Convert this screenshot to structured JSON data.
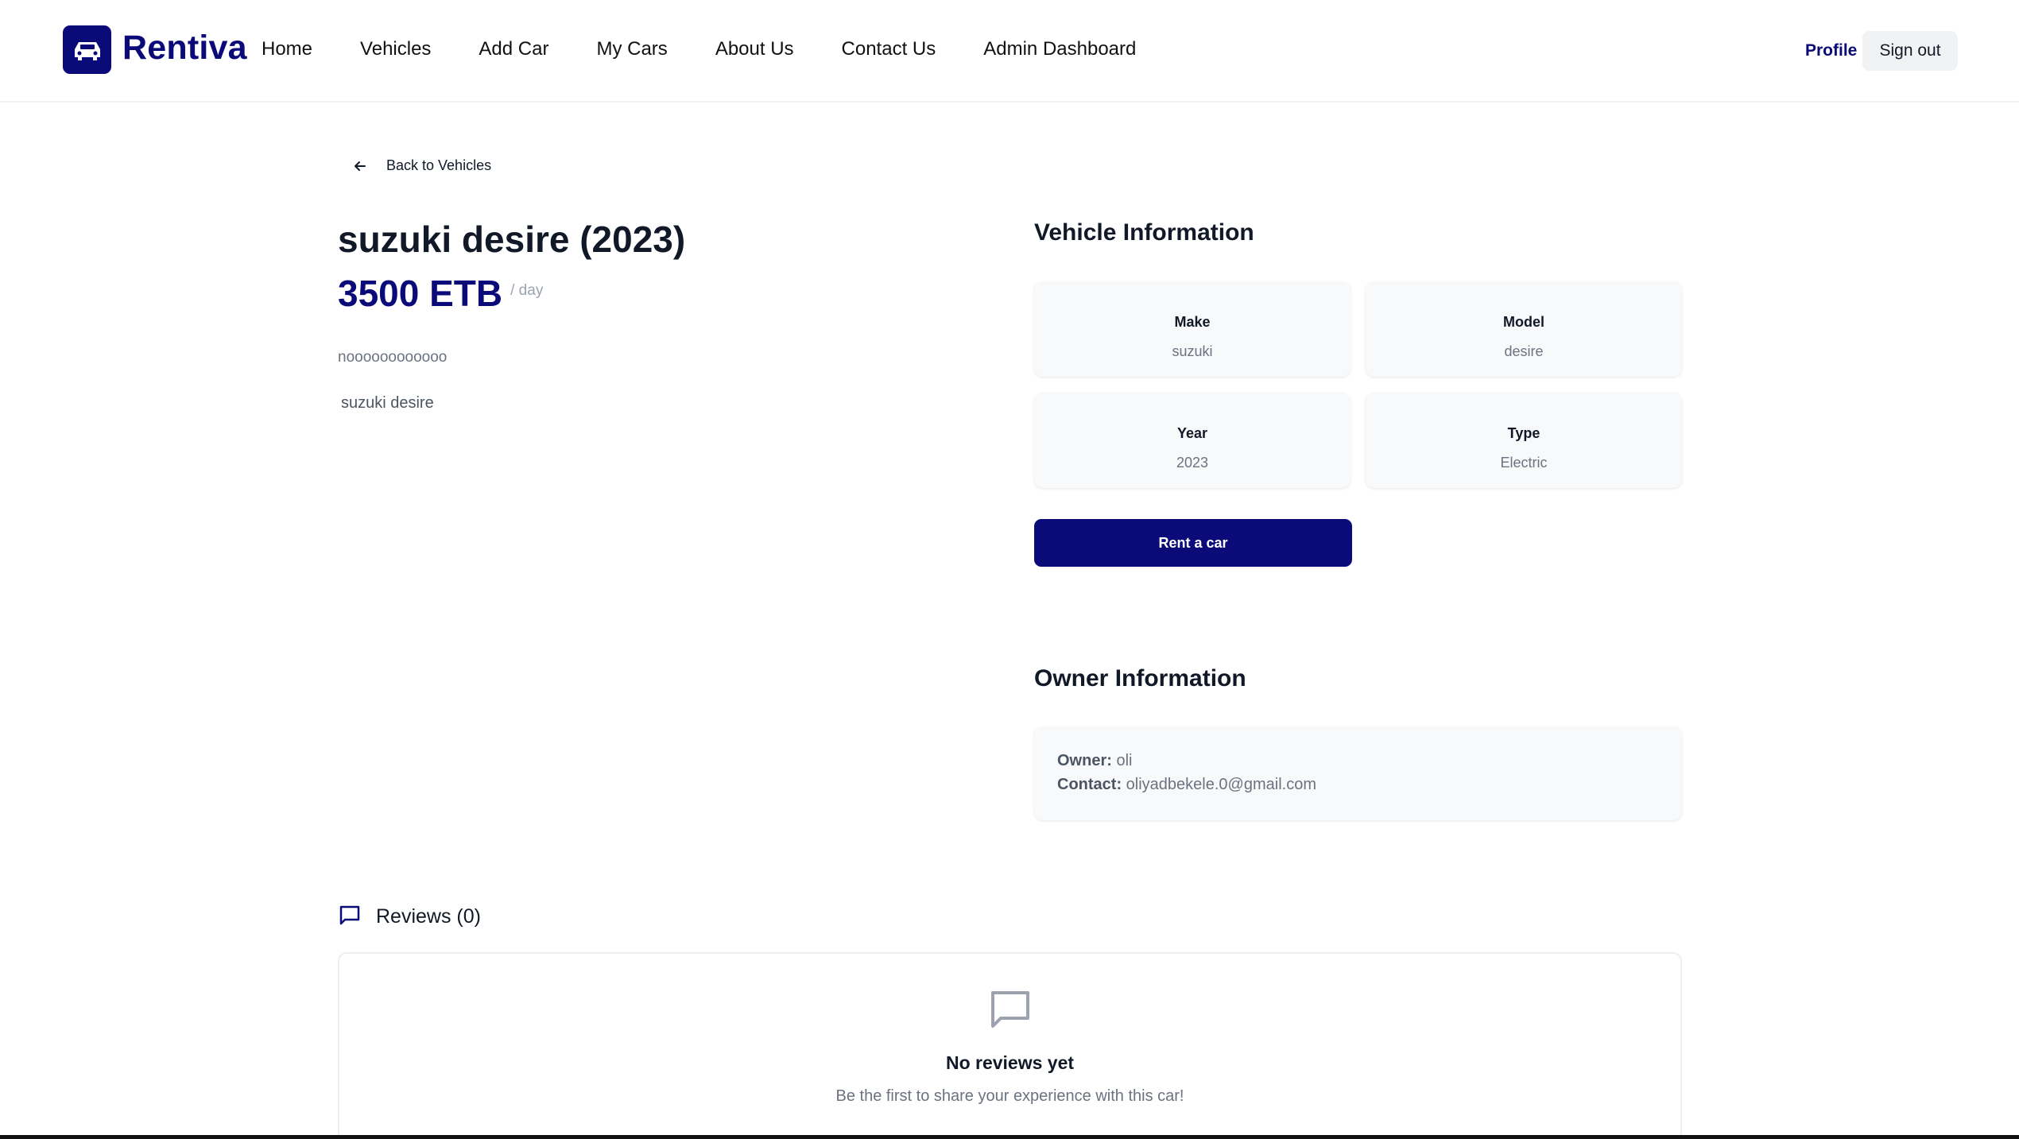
{
  "header": {
    "brand": "Rentiva",
    "nav": [
      "Home",
      "Vehicles",
      "Add Car",
      "My Cars",
      "About Us",
      "Contact Us",
      "Admin Dashboard"
    ],
    "profile_label": "Profile",
    "signout_label": "Sign out"
  },
  "back_label": "Back to Vehicles",
  "car": {
    "title": "suzuki desire (2023)",
    "price": "3500 ETB",
    "per_day": "/ day",
    "description": "noooooooooooo",
    "image_alt": "suzuki desire"
  },
  "vehicle_info": {
    "heading": "Vehicle Information",
    "fields": [
      {
        "label": "Make",
        "value": "suzuki"
      },
      {
        "label": "Model",
        "value": "desire"
      },
      {
        "label": "Year",
        "value": "2023"
      },
      {
        "label": "Type",
        "value": "Electric"
      }
    ],
    "rent_label": "Rent a car"
  },
  "owner_info": {
    "heading": "Owner Information",
    "owner_label": "Owner:",
    "owner_value": "oli",
    "contact_label": "Contact:",
    "contact_value": "oliyadbekele.0@gmail.com"
  },
  "reviews": {
    "heading": "Reviews (0)",
    "empty_title": "No reviews yet",
    "empty_sub": "Be the first to share your experience with this car!"
  },
  "colors": {
    "brand": "#0a0a78",
    "muted": "#6b7280",
    "card_bg": "#f8f9fb"
  },
  "icons": {
    "logo": "car-icon",
    "back": "arrow-left-icon",
    "reviews": "message-square-icon",
    "empty": "message-square-icon"
  }
}
